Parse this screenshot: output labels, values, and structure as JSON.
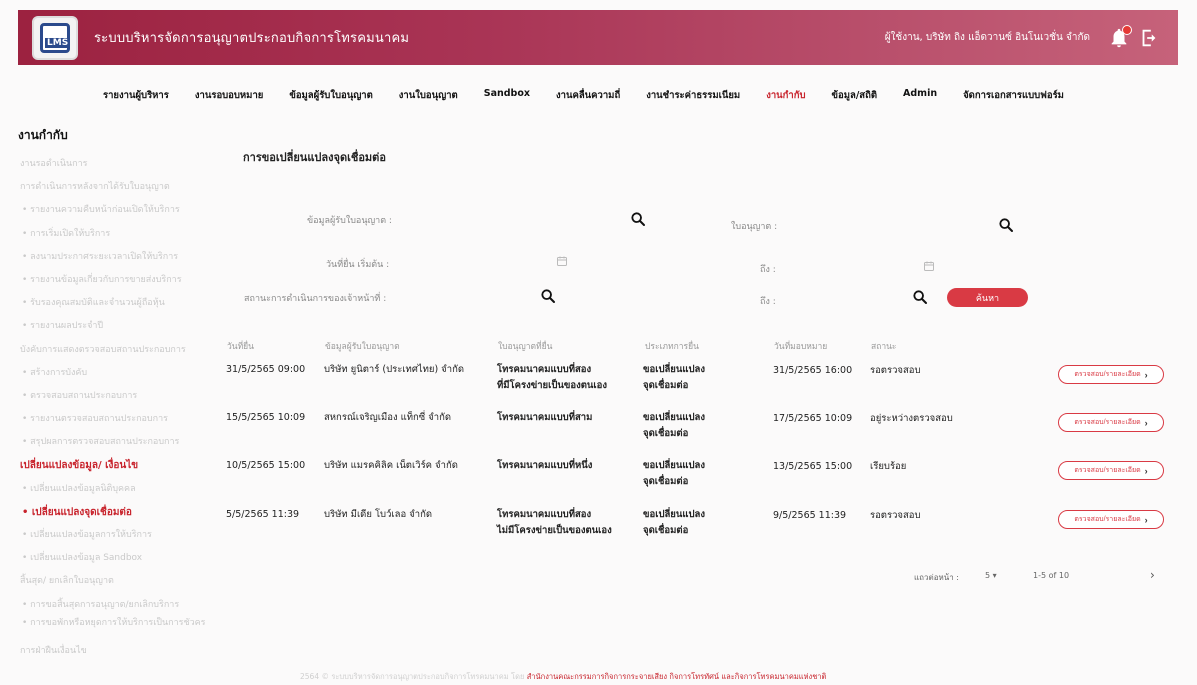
{
  "header": {
    "logo_text": "LMS",
    "title": "ระบบบริหารจัดการอนุญาตประกอบกิจการโทรคมนาคม",
    "user": "ผู้ใช้งาน, บริษัท ถิง แอ็ดวานซ์ อินโนเวชั่น จำกัด"
  },
  "nav": {
    "items": [
      "รายงานผู้บริหาร",
      "งานรอบอบหมาย",
      "ข้อมูลผู้รับใบอนุญาต",
      "งานใบอนุญาต",
      "Sandbox",
      "งานคลื่นความถี่",
      "งานชำระค่าธรรมเนียม",
      "งานกำกับ",
      "ข้อมูล/สถิติ",
      "Admin",
      "จัดการเอกสารแบบฟอร์ม"
    ],
    "active_index": 7
  },
  "sidebar": {
    "heading": "งานกำกับ",
    "items": [
      "งานรอดำเนินการ",
      "การดำเนินการหลังจากได้รับใบอนุญาต",
      "• รายงานความคืบหน้าก่อนเปิดให้บริการ",
      "• การเริ่มเปิดให้บริการ",
      "• ลงนามประกาศระยะเวลาเปิดให้บริการ",
      "• รายงานข้อมูลเกี่ยวกับการขายส่งบริการ",
      "• รับรองคุณสมบัติและจำนวนผู้ถือหุ้น",
      "• รายงานผลประจำปี",
      "บังคับการแสดงตรวจสอบสถานประกอบการ",
      "• สร้างการบังคับ",
      "• ตรวจสอบสถานประกอบการ",
      "• รายงานตรวจสอบสถานประกอบการ",
      "• สรุปผลการตรวจสอบสถานประกอบการ",
      "เปลี่ยนแปลงข้อมูล/ เงื่อนไข",
      "• เปลี่ยนแปลงข้อมูลนิติบุคคล",
      "• เปลี่ยนแปลงจุดเชื่อมต่อ",
      "• เปลี่ยนแปลงข้อมูลการให้บริการ",
      "• เปลี่ยนแปลงข้อมูล Sandbox",
      "สิ้นสุด/ ยกเลิกใบอนุญาต",
      "• การขอสิ้นสุดการอนุญาต/ยกเลิกบริการ",
      "• การขอพักหรือหยุดการให้บริการเป็นการชั่วคราว",
      "การฝ่าฝืนเงื่อนไข"
    ]
  },
  "main": {
    "title": "การขอเปลี่ยนแปลงจุดเชื่อมต่อ",
    "filters": {
      "licensee": "ข้อมูลผู้รับใบอนุญาต :",
      "license": "ใบอนุญาต :",
      "date_from": "วันที่ยื่น เริ่มต้น :",
      "date_to": "ถึง :",
      "status": "สถานะการดำเนินการของเจ้าหน้าที่ :",
      "status_to": "ถึง :",
      "search_label": "ค้นหา"
    },
    "columns": [
      "วันที่ยื่น",
      "ข้อมูลผู้รับใบอนุญาต",
      "ใบอนุญาตที่ยื่น",
      "ประเภทการยื่น",
      "วันที่มอบหมาย",
      "สถานะ"
    ],
    "rows": [
      {
        "submitted": "31/5/2565  09:00",
        "licensee": "บริษัท ยูนิตาร์ (ประเทศไทย) จำกัด",
        "license_l1": "โทรคมนาคมแบบที่สอง",
        "license_l2": "ที่มีโครงข่ายเป็นของตนเอง",
        "type_l1": "ขอเปลี่ยนแปลง",
        "type_l2": "จุดเชื่อมต่อ",
        "assigned": "31/5/2565  16:00",
        "status": "รอตรวจสอบ",
        "action": "ตรวจสอบ/รายละเอียด"
      },
      {
        "submitted": "15/5/2565  10:09",
        "licensee": "สหกรณ์เจริญเมือง แท็กซี่ จำกัด",
        "license_l1": "โทรคมนาคมแบบที่สาม",
        "license_l2": "",
        "type_l1": "ขอเปลี่ยนแปลง",
        "type_l2": "จุดเชื่อมต่อ",
        "assigned": "17/5/2565  10:09",
        "status": "อยู่ระหว่างตรวจสอบ",
        "action": "ตรวจสอบ/รายละเอียด"
      },
      {
        "submitted": "10/5/2565  15:00",
        "licensee": "บริษัท แมรคคิลิค เน็ตเวิร์ค จำกัด",
        "license_l1": "โทรคมนาคมแบบที่หนึ่ง",
        "license_l2": "",
        "type_l1": "ขอเปลี่ยนแปลง",
        "type_l2": "จุดเชื่อมต่อ",
        "assigned": "13/5/2565  15:00",
        "status": "เรียบร้อย",
        "action": "ตรวจสอบ/รายละเอียด"
      },
      {
        "submitted": "5/5/2565  11:39",
        "licensee": "บริษัท มีเดีย โบว์เลอ จำกัด",
        "license_l1": "โทรคมนาคมแบบที่สอง",
        "license_l2": "ไม่มีโครงข่ายเป็นของตนเอง",
        "type_l1": "ขอเปลี่ยนแปลง",
        "type_l2": "จุดเชื่อมต่อ",
        "assigned": "9/5/2565  11:39",
        "status": "รอตรวจสอบ",
        "action": "ตรวจสอบ/รายละเอียด"
      }
    ],
    "pager": {
      "rows_per_page_label": "แถวต่อหน้า :",
      "rows_per_page": "5",
      "range": "1-5 of 10",
      "next": "›"
    }
  },
  "footer": {
    "text": "2564 © ระบบบริหารจัดการอนุญาตประกอบกิจการโทรคมนาคม โดย",
    "org": "สำนักงานคณะกรรมการกิจการกระจายเสียง กิจการโทรทัศน์ และกิจการโทรคมนาคมแห่งชาติ"
  },
  "colors": {
    "brand": "#9c2240",
    "accent": "#d93a44",
    "active": "#c8232c"
  }
}
